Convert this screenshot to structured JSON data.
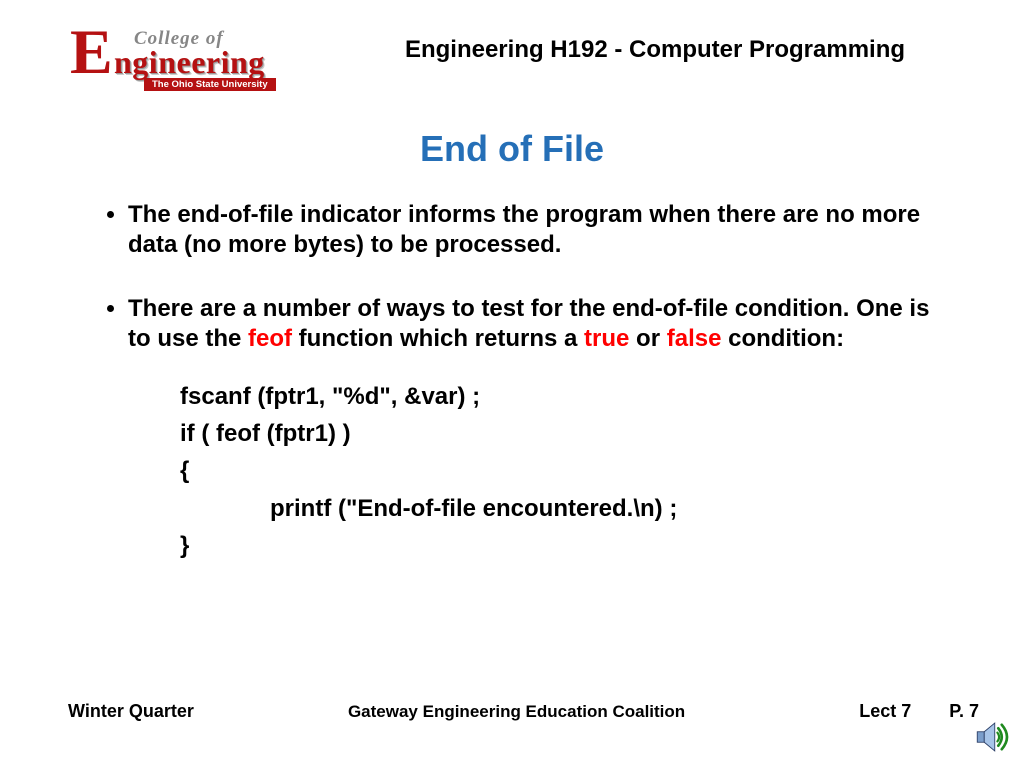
{
  "header": {
    "logo": {
      "big_e": "E",
      "college_of": "College of",
      "ngineering": "ngineering",
      "osu": "The Ohio State University"
    },
    "course": "Engineering H192  - Computer Programming"
  },
  "title": "End of File",
  "bullets": {
    "b1": "The end-of-file indicator informs the program when there are no more data (no more bytes) to be processed.",
    "b2_pre": "There are a number of ways to test for the end-of-file condition.  One is to use the ",
    "b2_feof": "feof",
    "b2_mid": " function which returns a ",
    "b2_true": "true",
    "b2_or": " or ",
    "b2_false": "false",
    "b2_post": " condition:"
  },
  "code": {
    "l1": "fscanf (fptr1, \"%d\", &var) ;",
    "l2": "if ( feof (fptr1) )",
    "l3": "{",
    "l4": "printf (\"End-of-file encountered.\\n) ;",
    "l5": "}"
  },
  "footer": {
    "quarter": "Winter Quarter",
    "coalition": "Gateway Engineering Education Coalition",
    "lect": "Lect 7",
    "page": "P. 7"
  }
}
